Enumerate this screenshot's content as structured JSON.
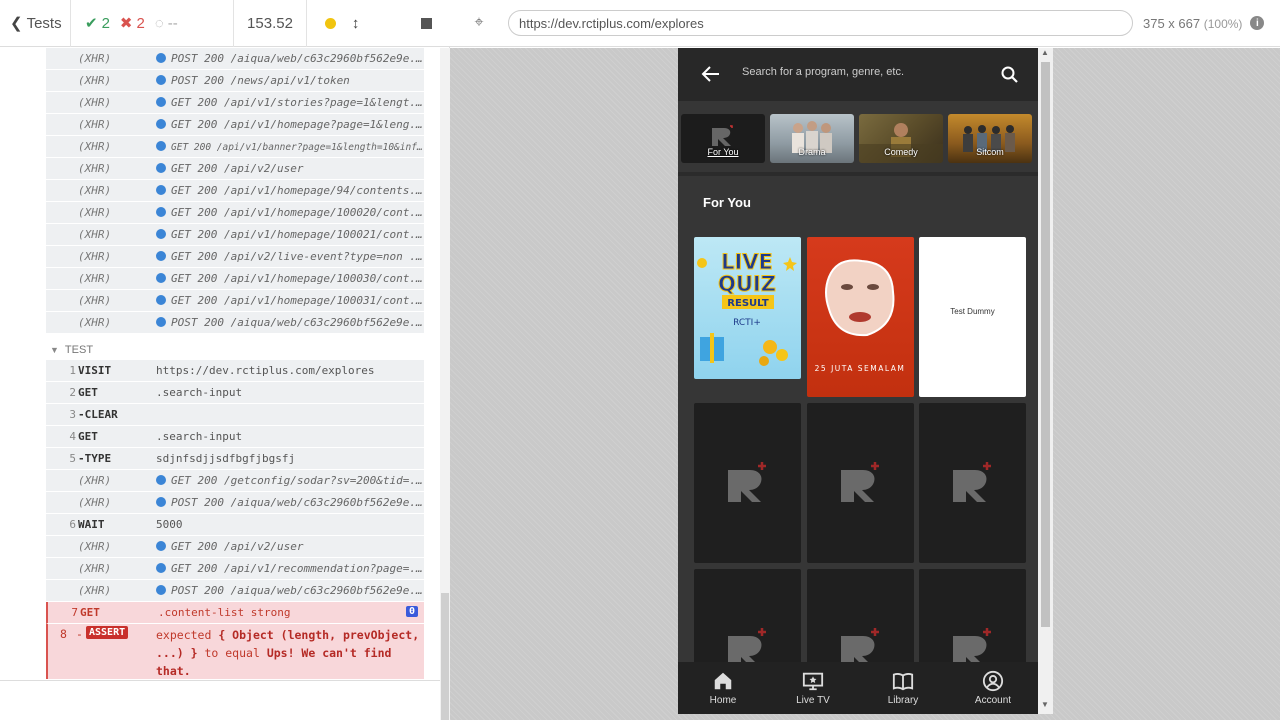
{
  "runner": {
    "back_label": "Tests",
    "passed": "2",
    "failed": "2",
    "pending": "--",
    "duration": "153.52",
    "test_section": "TEST",
    "xhr_commands": [
      {
        "name": "(XHR)",
        "msg": "POST 200 /aiqua/web/c63c2960bf562e9e..."
      },
      {
        "name": "(XHR)",
        "msg": "POST 200 /news/api/v1/token"
      },
      {
        "name": "(XHR)",
        "msg": "GET 200 /api/v1/stories?page=1&lengt..."
      },
      {
        "name": "(XHR)",
        "msg": "GET 200 /api/v1/homepage?page=1&leng..."
      },
      {
        "name": "(XHR)",
        "msg": "GET 200 /api/v1/banner?page=1&length=10&inf..."
      },
      {
        "name": "(XHR)",
        "msg": "GET 200 /api/v2/user"
      },
      {
        "name": "(XHR)",
        "msg": "GET 200 /api/v1/homepage/94/contents..."
      },
      {
        "name": "(XHR)",
        "msg": "GET 200 /api/v1/homepage/100020/cont..."
      },
      {
        "name": "(XHR)",
        "msg": "GET 200 /api/v1/homepage/100021/cont..."
      },
      {
        "name": "(XHR)",
        "msg": "GET 200 /api/v2/live-event?type=non ..."
      },
      {
        "name": "(XHR)",
        "msg": "GET 200 /api/v1/homepage/100030/cont..."
      },
      {
        "name": "(XHR)",
        "msg": "GET 200 /api/v1/homepage/100031/cont..."
      },
      {
        "name": "(XHR)",
        "msg": "POST 200 /aiqua/web/c63c2960bf562e9e..."
      }
    ],
    "test_commands": [
      {
        "num": "1",
        "name": "VISIT",
        "msg": "https://dev.rctiplus.com/explores"
      },
      {
        "num": "2",
        "name": "GET",
        "msg": ".search-input"
      },
      {
        "num": "3",
        "name": "-CLEAR",
        "msg": ""
      },
      {
        "num": "4",
        "name": "GET",
        "msg": ".search-input"
      },
      {
        "num": "5",
        "name": "-TYPE",
        "msg": "sdjnfsdjjsdfbgfjbgsfj"
      },
      {
        "num": "",
        "name": "(XHR)",
        "msg": "GET 200 /getconfig/sodar?sv=200&tid=..."
      },
      {
        "num": "",
        "name": "(XHR)",
        "msg": "POST 200 /aiqua/web/c63c2960bf562e9e..."
      },
      {
        "num": "6",
        "name": "WAIT",
        "msg": "5000"
      },
      {
        "num": "",
        "name": "(XHR)",
        "msg": "GET 200 /api/v2/user"
      },
      {
        "num": "",
        "name": "(XHR)",
        "msg": "GET 200 /api/v1/recommendation?page=..."
      },
      {
        "num": "",
        "name": "(XHR)",
        "msg": "POST 200 /aiqua/web/c63c2960bf562e9e..."
      }
    ],
    "fail_get": {
      "num": "7",
      "name": "GET",
      "msg": ".content-list strong",
      "badge": "0"
    },
    "assert": {
      "num": "8",
      "dash": "-",
      "tag": "ASSERT",
      "expected": "expected",
      "obj": "{ Object (length, prevObject, ...) }",
      "to_equal": "to equal",
      "value": "Ups! We can't find that."
    }
  },
  "aut": {
    "url": "https://dev.rctiplus.com/explores",
    "viewport": "375 x 667",
    "zoom": "(100%)",
    "info": "i"
  },
  "phone": {
    "search_placeholder": "Search for a program, genre, etc.",
    "categories": [
      "For You",
      "Drama",
      "Comedy",
      "Sitcom"
    ],
    "section_title": "For You",
    "tiles": {
      "quiz_line1": "LIVE",
      "quiz_line2": "QUIZ",
      "quiz_result": "RESULT",
      "quiz_brand": "RCTI+",
      "movie_title": "25 JUTA SEMALAM",
      "dummy_title": "Test Dummy"
    },
    "nav": [
      "Home",
      "Live TV",
      "Library",
      "Account"
    ]
  }
}
